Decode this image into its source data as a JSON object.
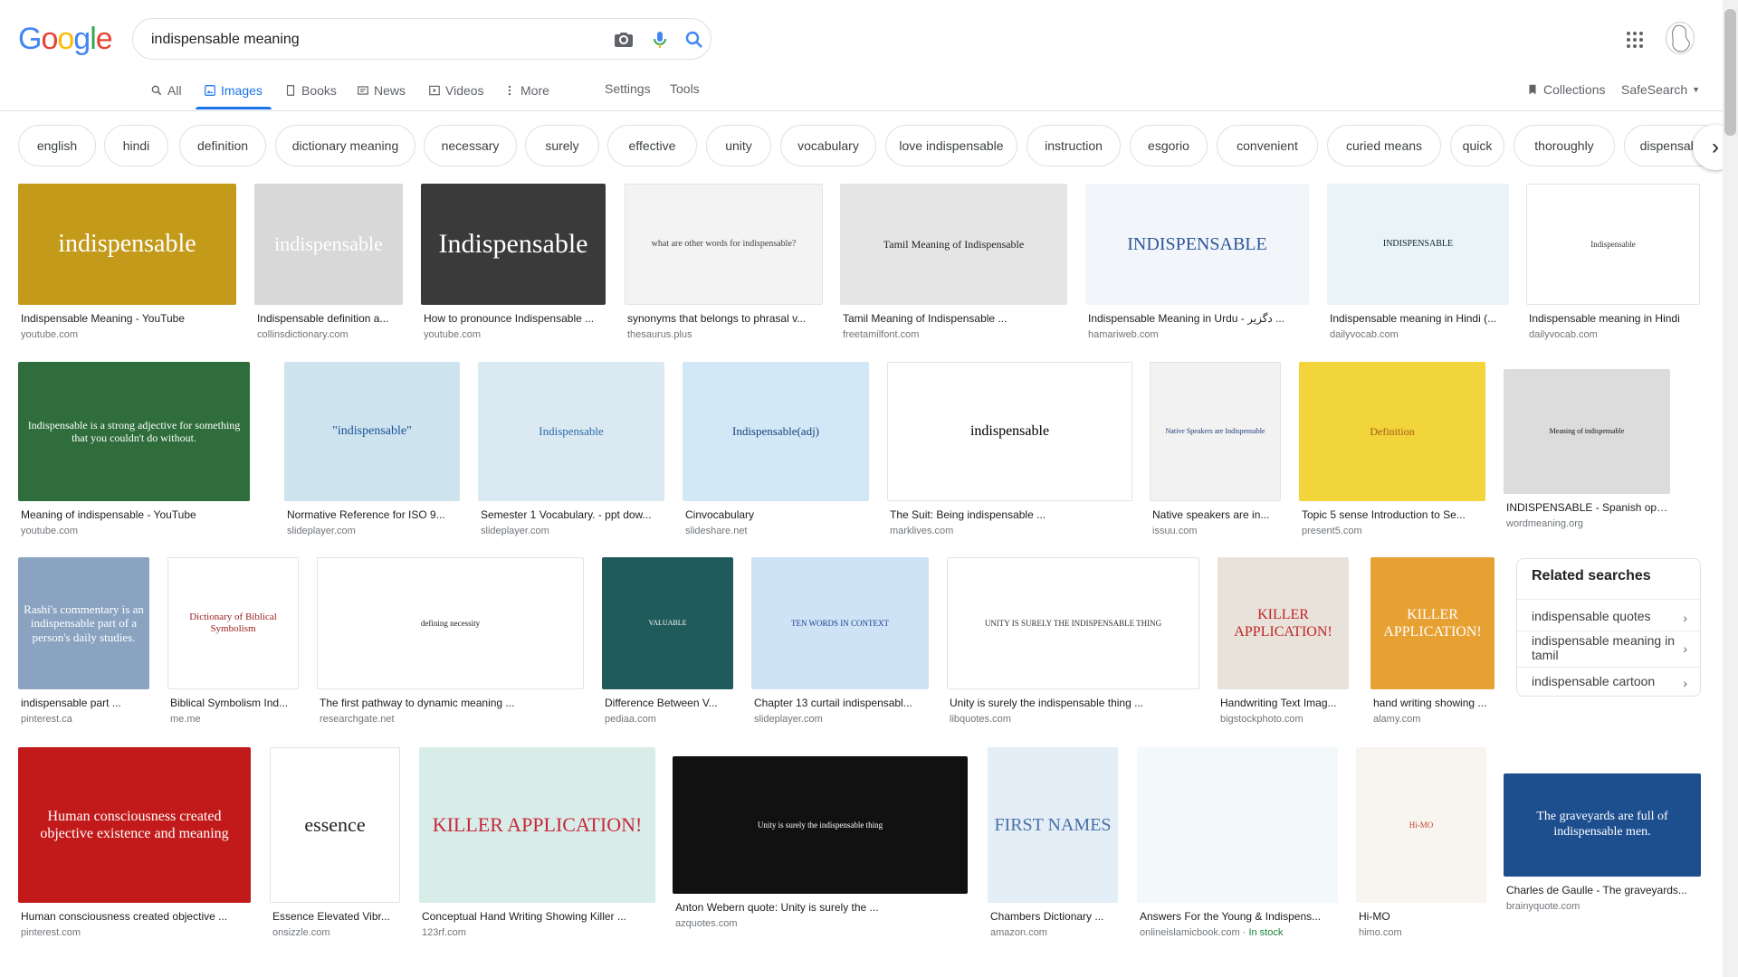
{
  "logo": {
    "letters": [
      "G",
      "o",
      "o",
      "g",
      "l",
      "e"
    ]
  },
  "search": {
    "query": "indispensable meaning"
  },
  "tabs": [
    {
      "label": "All"
    },
    {
      "label": "Images"
    },
    {
      "label": "Books"
    },
    {
      "label": "News"
    },
    {
      "label": "Videos"
    },
    {
      "label": "More"
    }
  ],
  "nav_links": {
    "settings": "Settings",
    "tools": "Tools",
    "collections": "Collections",
    "safesearch": "SafeSearch"
  },
  "chips": [
    "english",
    "hindi",
    "definition",
    "dictionary meaning",
    "necessary",
    "surely",
    "effective",
    "unity",
    "vocabulary",
    "love indispensable",
    "instruction",
    "esgorio",
    "convenient",
    "curied means",
    "quick",
    "thoroughly",
    "dispensable"
  ],
  "results": [
    {
      "caption": "Indispensable Meaning - YouTube",
      "source": "youtube.com",
      "text": "indispensable"
    },
    {
      "caption": "Indispensable definition a...",
      "source": "collinsdictionary.com",
      "text": "indispensable"
    },
    {
      "caption": "How to pronounce Indispensable ...",
      "source": "youtube.com",
      "text": "Indispensable"
    },
    {
      "caption": "synonyms that belongs to phrasal v...",
      "source": "thesaurus.plus",
      "text": "what are other words for indispensable?"
    },
    {
      "caption": "Tamil Meaning of Indispensable ...",
      "source": "freetamilfont.com",
      "text": "Tamil Meaning of Indispensable"
    },
    {
      "caption": "Indispensable Meaning in Urdu - دگزیر ...",
      "source": "hamariweb.com",
      "text": "INDISPENSABLE"
    },
    {
      "caption": "Indispensable meaning in Hindi (...",
      "source": "dailyvocab.com",
      "text": "INDISPENSABLE"
    },
    {
      "caption": "Indispensable meaning in Hindi",
      "source": "dailyvocab.com",
      "text": "Indispensable"
    },
    {
      "caption": "Meaning of indispensable - YouTube",
      "source": "youtube.com",
      "text": "Indispensable is a strong adjective for something that you couldn't do without."
    },
    {
      "caption": "Normative Reference for ISO 9...",
      "source": "slideplayer.com",
      "text": "\"indispensable\""
    },
    {
      "caption": "Semester 1 Vocabulary. - ppt dow...",
      "source": "slideplayer.com",
      "text": "Indispensable"
    },
    {
      "caption": "Cinvocabulary",
      "source": "slideshare.net",
      "text": "Indispensable(adj)"
    },
    {
      "caption": "The Suit: Being indispensable ...",
      "source": "marklives.com",
      "text": "indispensable"
    },
    {
      "caption": "Native speakers are in...",
      "source": "issuu.com",
      "text": "Native Speakers are Indispensable"
    },
    {
      "caption": "Topic 5 sense Introduction to Se...",
      "source": "present5.com",
      "text": "Definition"
    },
    {
      "caption": "INDISPENSABLE - Spanish open d...",
      "source": "wordmeaning.org",
      "text": "Meaning of indispensable"
    },
    {
      "caption": "indispensable part ...",
      "source": "pinterest.ca",
      "text": "Rashi's commentary is an indispensable part of a person's daily studies."
    },
    {
      "caption": "Biblical Symbolism Ind...",
      "source": "me.me",
      "text": "Dictionary of Biblical Symbolism"
    },
    {
      "caption": "The first pathway to dynamic meaning ...",
      "source": "researchgate.net",
      "text": "defining necessity"
    },
    {
      "caption": "Difference Between V...",
      "source": "pediaa.com",
      "text": "VALUABLE"
    },
    {
      "caption": "Chapter 13 curtail indispensabl...",
      "source": "slideplayer.com",
      "text": "TEN WORDS IN CONTEXT"
    },
    {
      "caption": "Unity is surely the indispensable thing ...",
      "source": "libquotes.com",
      "text": "UNITY IS SURELY THE INDISPENSABLE THING"
    },
    {
      "caption": "Handwriting Text Imag...",
      "source": "bigstockphoto.com",
      "text": "KILLER APPLICATION!"
    },
    {
      "caption": "hand writing showing ...",
      "source": "alamy.com",
      "text": "KILLER APPLICATION!"
    },
    {
      "caption": "Human consciousness created objective ...",
      "source": "pinterest.com",
      "text": "Human consciousness created objective existence and meaning"
    },
    {
      "caption": "Essence Elevated Vibr...",
      "source": "onsizzle.com",
      "text": "essence"
    },
    {
      "caption": "Conceptual Hand Writing Showing Killer ...",
      "source": "123rf.com",
      "text": "KILLER APPLICATION!"
    },
    {
      "caption": "Anton Webern quote: Unity is surely the ...",
      "source": "azquotes.com",
      "text": "Unity is surely the indispensable thing"
    },
    {
      "caption": "Chambers Dictionary ...",
      "source": "amazon.com",
      "text": "FIRST NAMES"
    },
    {
      "caption": "Answers For the Young & Indispens...",
      "source": "onlineislamicbook.com",
      "stock": "In stock",
      "text": ""
    },
    {
      "caption": "Hi-MO",
      "source": "himo.com",
      "text": "Hi-MO"
    },
    {
      "caption": "Charles de Gaulle - The graveyards...",
      "source": "brainyquote.com",
      "text": "The graveyards are full of indispensable men."
    }
  ],
  "related": {
    "title": "Related searches",
    "items": [
      "indispensable quotes",
      "indispensable meaning in tamil",
      "indispensable cartoon"
    ]
  }
}
